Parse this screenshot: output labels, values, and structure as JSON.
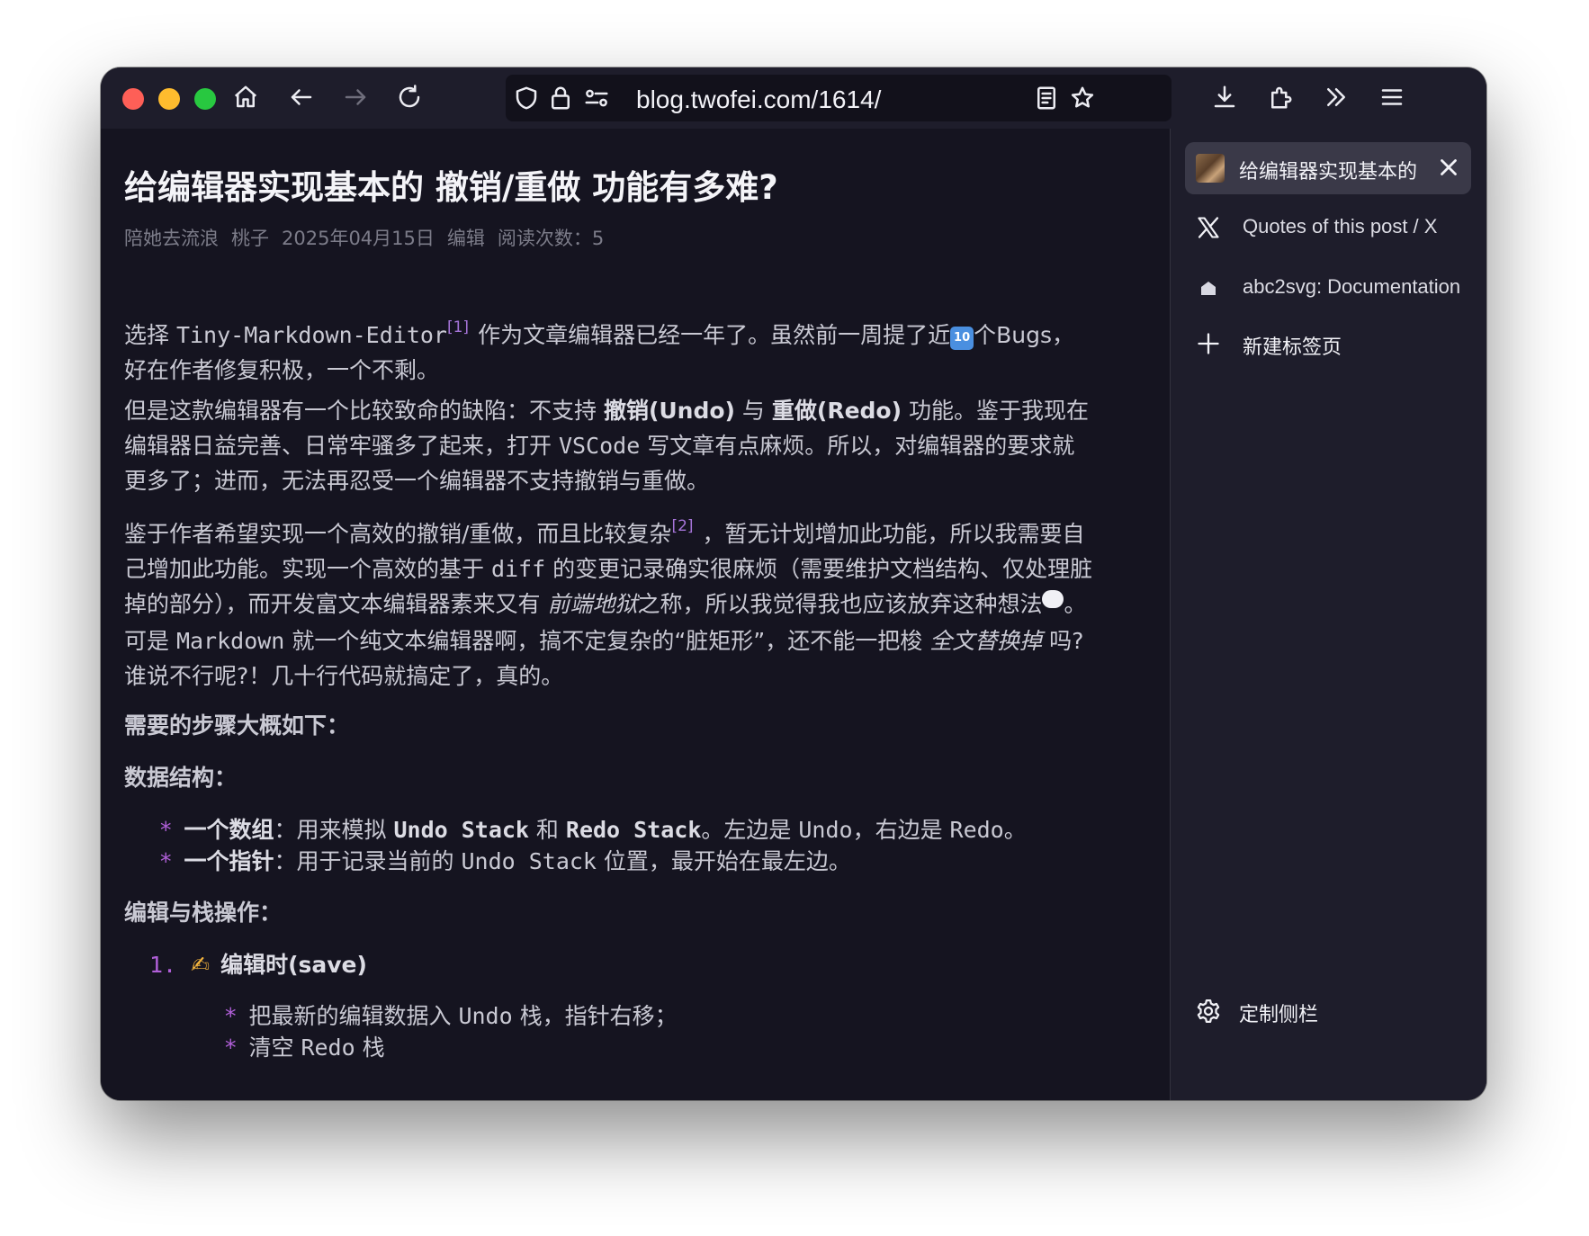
{
  "browser": {
    "url": "blog.twofei.com/1614/",
    "toolbar_icons": [
      "home-icon",
      "back-icon",
      "forward-icon",
      "reload-icon",
      "shield-icon",
      "lock-icon",
      "permissions-icon",
      "reader-view-icon",
      "bookmark-star-icon",
      "download-icon",
      "extensions-icon",
      "overflow-icon",
      "menu-icon"
    ]
  },
  "article": {
    "title": "给编辑器实现基本的 撤销/重做 功能有多难?",
    "meta": {
      "author": "陪她去流浪",
      "category": "桃子",
      "date": "2025年04月15日",
      "edit": "编辑",
      "reads_label": "阅读次数：",
      "reads": "5"
    },
    "p1": {
      "a": "选择 ",
      "code": "Tiny-Markdown-Editor",
      "ref": "[1]",
      "b": "作为文章编辑器已经一年了。虽然前一周提了近",
      "emoji": "10",
      "c": "个Bugs，",
      "line2": "好在作者修复积极，一个不剩。"
    },
    "p2": {
      "a": "但是这款编辑器有一个比较致命的缺陷：不支持 ",
      "undo": "撤销(Undo)",
      "and": " 与 ",
      "redo": "重做(Redo)",
      "b": " 功能。鉴于我现在",
      "line2a": "编辑器日益完善、日常牢骚多了起来，打开 ",
      "vscode": "VSCode",
      "line2b": " 写文章有点麻烦。所以，对编辑器的要求就",
      "line3": "更多了；进而，无法再忍受一个编辑器不支持撤销与重做。"
    },
    "p3": {
      "a": "鉴于作者希望实现一个高效的撤销/重做，而且比较复杂",
      "ref": "[2]",
      "b": "，暂无计划增加此功能，所以我需要自",
      "line2a": "己增加此功能。实现一个高效的基于 ",
      "diff": "diff",
      "line2b": " 的变更记录确实很麻烦（需要维护文档结构、仅处理脏",
      "line3a": "掉的部分），而开发富文本编辑器素来又有 ",
      "hell": "前端地狱",
      "line3b": "之称，所以我觉得我也应该放弃这种想法",
      "line3c": "。"
    },
    "p4": {
      "a": "可是 ",
      "markdown": "Markdown",
      "b": " 就一个纯文本编辑器啊，搞不定复杂的“脏矩形”，还不能一把梭 ",
      "replace": "全文替换掉",
      "c": " 吗?",
      "line2": "谁说不行呢?！几十行代码就搞定了，真的。"
    },
    "h_steps": "需要的步骤大概如下：",
    "h_data": "数据结构：",
    "data_items": [
      {
        "bullet": "*",
        "term": "一个数组",
        "sep": "：用来模拟 ",
        "code1": "Undo Stack",
        "mid": " 和 ",
        "code2": "Redo Stack",
        "after": "。左边是 ",
        "code3": "Undo",
        "after2": "，右边是 ",
        "code4": "Redo",
        "end": "。"
      },
      {
        "bullet": "*",
        "term": "一个指针",
        "sep": "：用于记录当前的 ",
        "code1": "Undo Stack",
        "after": " 位置，最开始在最左边。"
      }
    ],
    "h_ops": "编辑与栈操作：",
    "ol_1": {
      "num": "1.",
      "emoji": "✍",
      "label": "编辑时(save)"
    },
    "ol_1_items": [
      {
        "bullet": "*",
        "a": "把最新的编辑数据入 ",
        "code": "Undo",
        "b": " 栈，指针右移；"
      },
      {
        "bullet": "*",
        "a": "清空 ",
        "code": "Redo",
        "b": " 栈"
      }
    ]
  },
  "sidebar": {
    "active_tab": {
      "label": "给编辑器实现基本的 撤销/重做 功能有多难?",
      "close": "✕"
    },
    "tabs": [
      {
        "label": "Quotes of this post / X",
        "icon": "x-logo-icon"
      },
      {
        "label": "abc2svg: Documentation",
        "icon": "abc2svg-site-icon"
      }
    ],
    "new_tab": "新建标签页",
    "customize": "定制侧栏"
  },
  "colors": {
    "window_bg": "#141320",
    "toolbar_bg": "#1e1d2b",
    "accent_purple": "#b05fd8",
    "text": "#c9c9d3"
  }
}
